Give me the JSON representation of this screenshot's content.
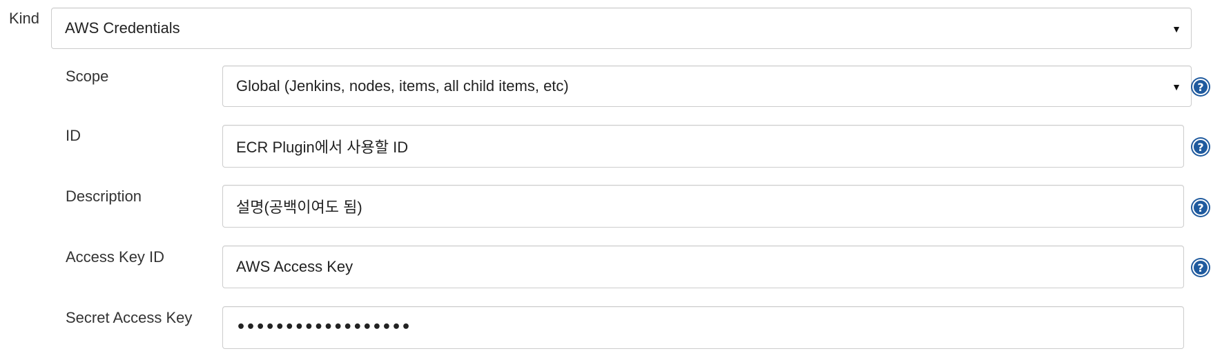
{
  "kind": {
    "label": "Kind",
    "value": "AWS Credentials",
    "arrow": "▼"
  },
  "scope": {
    "label": "Scope",
    "value": "Global (Jenkins, nodes, items, all child items, etc)",
    "arrow": "▼",
    "help_icon": "help-icon"
  },
  "id": {
    "label": "ID",
    "value": "ECR Plugin에서 사용할 ID",
    "help_icon": "help-icon"
  },
  "description": {
    "label": "Description",
    "value": "설명(공백이여도 됨)",
    "help_icon": "help-icon"
  },
  "access_key_id": {
    "label": "Access Key ID",
    "value": "AWS Access Key",
    "help_icon": "help-icon"
  },
  "secret_access_key": {
    "label": "Secret Access Key",
    "value": "••••••••••••••••••"
  },
  "colors": {
    "border": "#cccccc",
    "help_icon": "#1f5a9e",
    "text": "#333333"
  }
}
